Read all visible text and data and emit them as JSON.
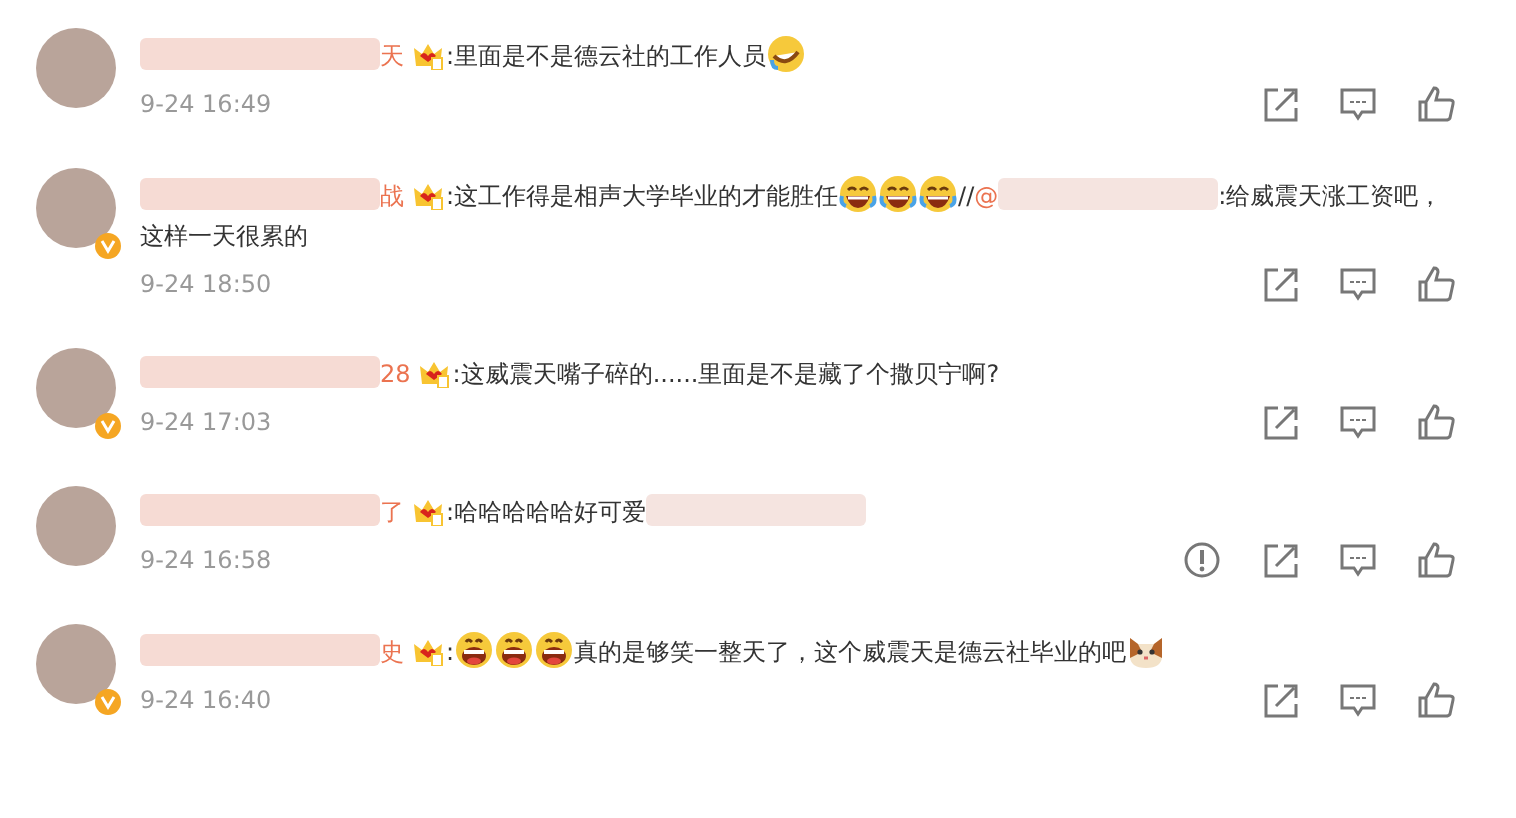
{
  "comments": [
    {
      "name": "天",
      "verified": false,
      "vip": true,
      "time": "9-24 16:49",
      "report_shown": false,
      "parts": [
        {
          "kind": "text",
          "text": ":里面是不是德云社的工作人员"
        },
        {
          "kind": "tiltlaugh"
        }
      ]
    },
    {
      "name": "战",
      "verified": true,
      "vip": true,
      "time": "9-24 18:50",
      "report_shown": false,
      "parts": [
        {
          "kind": "text",
          "text": ":这工作得是相声大学毕业的才能胜任"
        },
        {
          "kind": "laughcry"
        },
        {
          "kind": "laughcry"
        },
        {
          "kind": "laughcry"
        },
        {
          "kind": "text",
          "text": "//"
        },
        {
          "kind": "mention",
          "text": "@"
        },
        {
          "kind": "blur"
        },
        {
          "kind": "text",
          "text": ":给威震天涨工资吧，"
        },
        {
          "kind": "break"
        },
        {
          "kind": "text",
          "text": "这样一天很累的"
        }
      ]
    },
    {
      "name": "28",
      "verified": true,
      "vip": true,
      "time": "9-24 17:03",
      "report_shown": false,
      "parts": [
        {
          "kind": "text",
          "text": ":这威震天嘴子碎的......里面是不是藏了个撒贝宁啊?"
        }
      ]
    },
    {
      "name": "了",
      "verified": false,
      "vip": true,
      "time": "9-24 16:58",
      "report_shown": true,
      "parts": [
        {
          "kind": "text",
          "text": ":哈哈哈哈哈好可爱"
        },
        {
          "kind": "blur"
        }
      ]
    },
    {
      "name": "史",
      "verified": true,
      "vip": true,
      "time": "9-24 16:40",
      "report_shown": false,
      "parts": [
        {
          "kind": "text",
          "text": ":"
        },
        {
          "kind": "grin"
        },
        {
          "kind": "grin"
        },
        {
          "kind": "grin"
        },
        {
          "kind": "text",
          "text": "真的是够笑一整天了，这个威震天是德云社毕业的吧"
        },
        {
          "kind": "cat"
        }
      ]
    }
  ]
}
